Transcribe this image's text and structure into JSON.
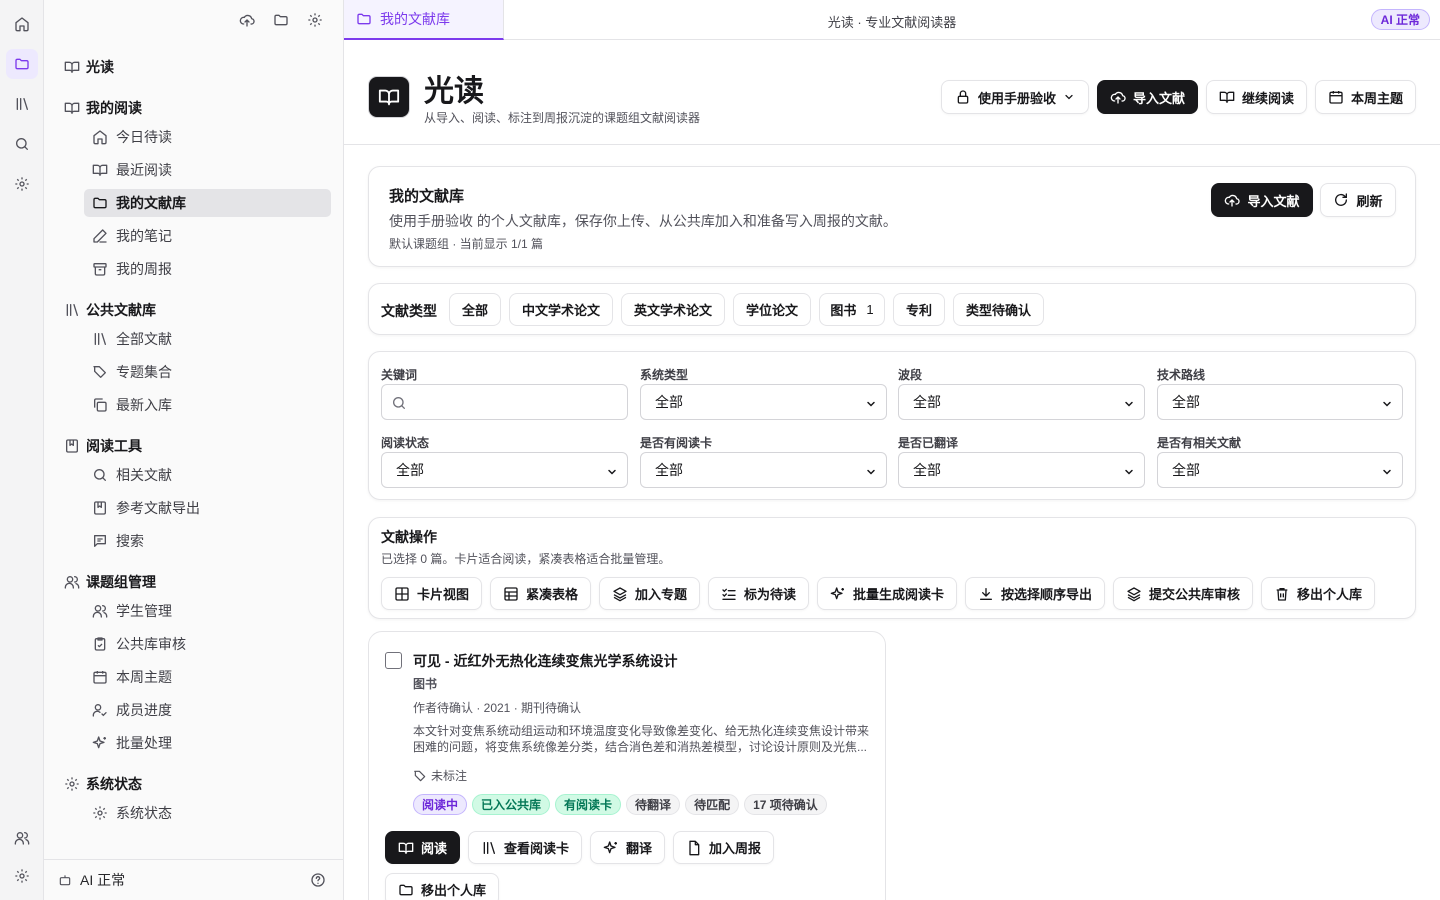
{
  "rail": [
    "home-icon",
    "folder-icon",
    "library-icon",
    "search-icon",
    "settings-icon",
    "users-icon",
    "settings-icon"
  ],
  "sidebar": {
    "brand": "光读",
    "sections": [
      {
        "label": "我的阅读",
        "items": [
          "今日待读",
          "最近阅读",
          "我的文献库",
          "我的笔记",
          "我的周报"
        ]
      },
      {
        "label": "公共文献库",
        "items": [
          "全部文献",
          "专题集合",
          "最新入库"
        ]
      },
      {
        "label": "阅读工具",
        "items": [
          "相关文献",
          "参考文献导出",
          "搜索"
        ]
      },
      {
        "label": "课题组管理",
        "items": [
          "学生管理",
          "公共库审核",
          "本周主题",
          "成员进度",
          "批量处理"
        ]
      },
      {
        "label": "系统状态",
        "items": [
          "系统状态"
        ]
      }
    ],
    "active_item": "我的文献库",
    "footer": "AI 正常"
  },
  "topbar": {
    "tab_label": "我的文献库",
    "app_title": "光读 · 专业文献阅读器",
    "ai_badge": "AI 正常"
  },
  "header": {
    "title": "光读",
    "subtitle": "从导入、阅读、标注到周报沉淀的课题组文献阅读器",
    "user_select": "使用手册验收",
    "import_btn": "导入文献",
    "continue_btn": "继续阅读",
    "theme_btn": "本周主题"
  },
  "library": {
    "title": "我的文献库",
    "desc": "使用手册验收 的个人文献库，保存你上传、从公共库加入和准备写入周报的文献。",
    "meta": "默认课题组 · 当前显示 1/1 篇",
    "import_btn": "导入文献",
    "refresh_btn": "刷新"
  },
  "types": {
    "label": "文献类型",
    "chips": [
      {
        "label": "全部",
        "count": ""
      },
      {
        "label": "中文学术论文",
        "count": ""
      },
      {
        "label": "英文学术论文",
        "count": ""
      },
      {
        "label": "学位论文",
        "count": ""
      },
      {
        "label": "图书",
        "count": "1"
      },
      {
        "label": "专利",
        "count": ""
      },
      {
        "label": "类型待确认",
        "count": ""
      }
    ]
  },
  "filters": {
    "keyword_label": "关键词",
    "keyword_value": "",
    "system_label": "系统类型",
    "band_label": "波段",
    "tech_label": "技术路线",
    "read_label": "阅读状态",
    "card_label": "是否有阅读卡",
    "translated_label": "是否已翻译",
    "related_label": "是否有相关文献",
    "all": "全部"
  },
  "actions": {
    "title": "文献操作",
    "desc": "已选择 0 篇。卡片适合阅读，紧凑表格适合批量管理。",
    "buttons": [
      "卡片视图",
      "紧凑表格",
      "加入专题",
      "标为待读",
      "批量生成阅读卡",
      "按选择顺序导出",
      "提交公共库审核",
      "移出个人库"
    ]
  },
  "doc": {
    "title": "可见 - 近红外无热化连续变焦光学系统设计",
    "type": "图书",
    "meta": "作者待确认 · 2021 · 期刊待确认",
    "abstract": "本文针对变焦系统动组运动和环境温度变化导致像差变化、给无热化连续变焦设计带来困难的问题，将变焦系统像差分类，结合消色差和消热差模型，讨论设计原则及光焦...",
    "tags": "未标注",
    "pills": [
      "阅读中",
      "已入公共库",
      "有阅读卡",
      "待翻译",
      "待匹配",
      "17 项待确认"
    ],
    "buttons": [
      "阅读",
      "查看阅读卡",
      "翻译",
      "加入周报",
      "移出个人库"
    ]
  },
  "colors": {
    "accent": "#7c3aed",
    "dark": "#18181b",
    "green": "#047857"
  }
}
